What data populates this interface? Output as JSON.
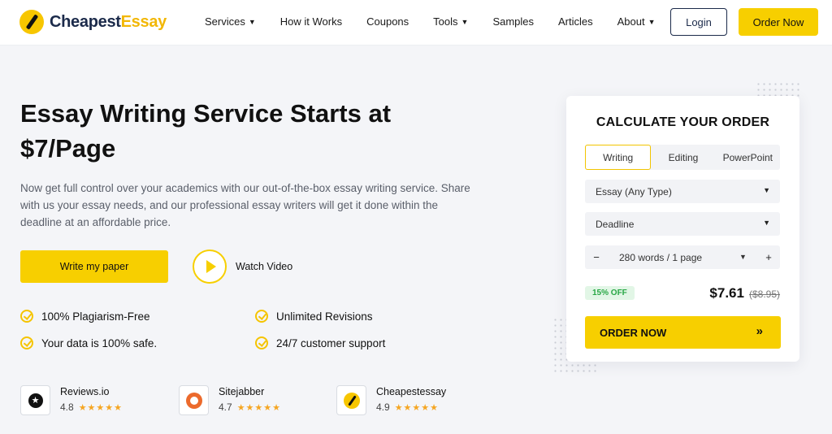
{
  "brand": {
    "name_part1": "Cheapest",
    "name_part2": "Essay",
    "accent": "#f7cf00",
    "navy": "#1b2a4a"
  },
  "nav": {
    "items": [
      {
        "label": "Services",
        "dropdown": true
      },
      {
        "label": "How it Works",
        "dropdown": false
      },
      {
        "label": "Coupons",
        "dropdown": false
      },
      {
        "label": "Tools",
        "dropdown": true
      },
      {
        "label": "Samples",
        "dropdown": false
      },
      {
        "label": "Articles",
        "dropdown": false
      },
      {
        "label": "About",
        "dropdown": true
      }
    ],
    "login_label": "Login",
    "order_label": "Order Now"
  },
  "hero": {
    "title_line1": "Essay Writing Service Starts at",
    "title_line2": "$7/Page",
    "description": "Now get full control over your academics with our out-of-the-box essay writing service. Share with us your essay needs, and our professional essay writers will get it done within the deadline at an affordable price.",
    "cta_label": "Write my paper",
    "video_label": "Watch Video"
  },
  "features": [
    "100% Plagiarism-Free",
    "Unlimited Revisions",
    "Your data is 100% safe.",
    "24/7 customer support"
  ],
  "reviews": [
    {
      "name": "Reviews.io",
      "rating": "4.8",
      "icon": "reviewsio-icon"
    },
    {
      "name": "Sitejabber",
      "rating": "4.7",
      "icon": "sitejabber-icon"
    },
    {
      "name": "Cheapestessay",
      "rating": "4.9",
      "icon": "cheapestessay-icon"
    }
  ],
  "calculator": {
    "title": "CALCULATE YOUR ORDER",
    "tabs": [
      "Writing",
      "Editing",
      "PowerPoint"
    ],
    "active_tab": "Writing",
    "paper_type": "Essay (Any Type)",
    "deadline": "Deadline",
    "pages": "280 words / 1 page",
    "minus": "−",
    "plus": "+",
    "discount": "15% OFF",
    "price": "$7.61",
    "old_price": "($8.95)",
    "order_label": "ORDER NOW",
    "order_arrows": "»"
  }
}
